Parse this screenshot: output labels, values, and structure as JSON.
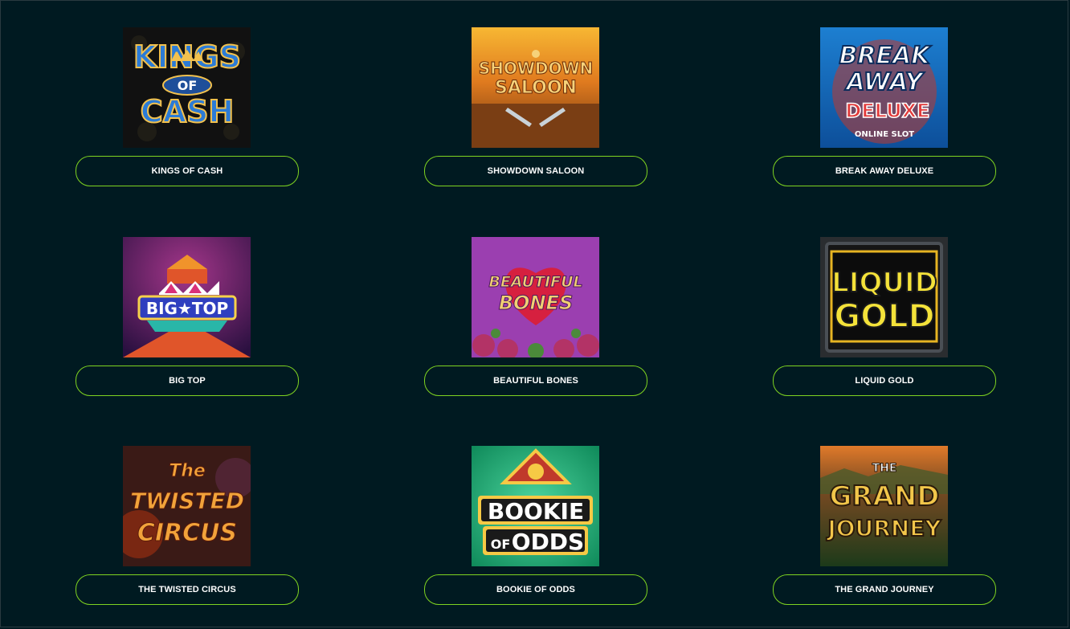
{
  "games": [
    {
      "title": "KINGS OF CASH",
      "logo_lines": [
        "KINGS",
        "OF",
        "CASH"
      ]
    },
    {
      "title": "SHOWDOWN SALOON",
      "logo_lines": [
        "SHOWDOWN",
        "SALOON"
      ]
    },
    {
      "title": "BREAK AWAY DELUXE",
      "logo_lines": [
        "BREAK",
        "AWAY",
        "DELUXE",
        "ONLINE SLOT"
      ]
    },
    {
      "title": "BIG TOP",
      "logo_lines": [
        "BIG★TOP"
      ]
    },
    {
      "title": "BEAUTIFUL BONES",
      "logo_lines": [
        "BEAUTIFUL",
        "BONES"
      ]
    },
    {
      "title": "LIQUID GOLD",
      "logo_lines": [
        "LIQUID",
        "GOLD"
      ]
    },
    {
      "title": "THE TWISTED CIRCUS",
      "logo_lines": [
        "The",
        "TWISTED",
        "CIRCUS"
      ]
    },
    {
      "title": "BOOKIE OF ODDS",
      "logo_lines": [
        "BOOKIE",
        "OF",
        "ODDS"
      ]
    },
    {
      "title": "THE GRAND JOURNEY",
      "logo_lines": [
        "THE",
        "GRAND",
        "JOURNEY"
      ]
    }
  ],
  "colors": {
    "background": "#001a21",
    "button_border": "#7ed321",
    "button_text": "#ffffff"
  }
}
